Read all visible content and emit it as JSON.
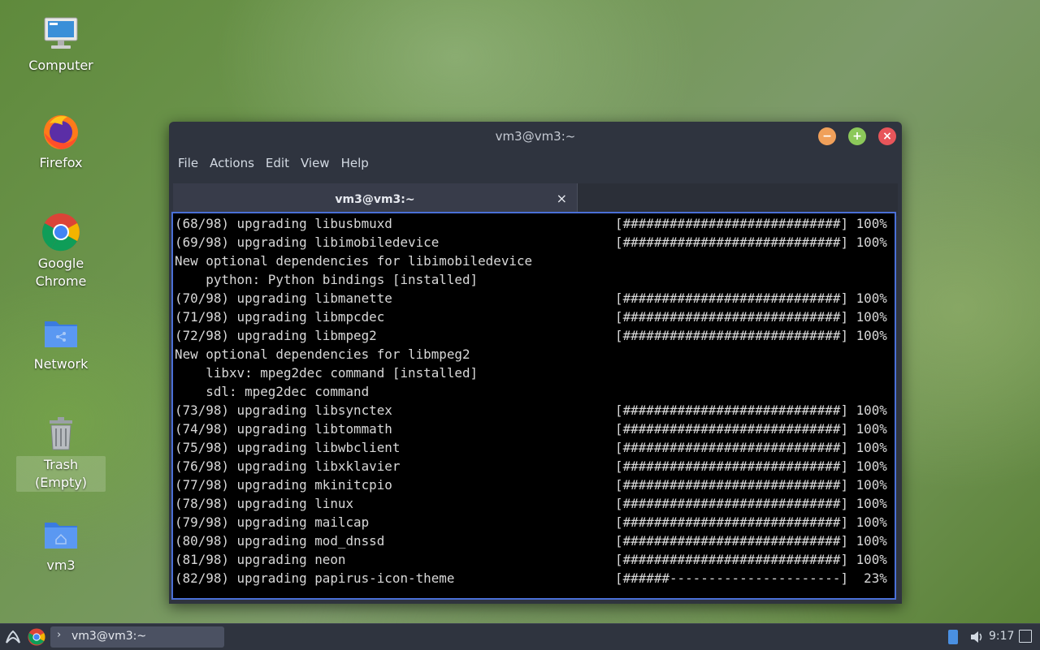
{
  "desktop": {
    "icons": [
      {
        "label": "Computer"
      },
      {
        "label": "Firefox"
      },
      {
        "label": "Google Chrome"
      },
      {
        "label": "Network"
      },
      {
        "label": "Trash (Empty)"
      },
      {
        "label": "vm3"
      }
    ]
  },
  "window": {
    "title": "vm3@vm3:~",
    "menu": [
      "File",
      "Actions",
      "Edit",
      "View",
      "Help"
    ],
    "tab": {
      "label": "vm3@vm3:~",
      "close": "×"
    },
    "colors": {
      "minimize": "#f0a05a",
      "maximize": "#8cc85a",
      "close": "#e8555a",
      "focus_border": "#4a6fd6"
    }
  },
  "terminal": {
    "lines": [
      {
        "left": "(68/98) upgrading libusbmuxd",
        "right": "[############################] 100%"
      },
      {
        "left": "(69/98) upgrading libimobiledevice",
        "right": "[############################] 100%"
      },
      {
        "left": "New optional dependencies for libimobiledevice",
        "right": ""
      },
      {
        "left": "    python: Python bindings [installed]",
        "right": ""
      },
      {
        "left": "(70/98) upgrading libmanette",
        "right": "[############################] 100%"
      },
      {
        "left": "(71/98) upgrading libmpcdec",
        "right": "[############################] 100%"
      },
      {
        "left": "(72/98) upgrading libmpeg2",
        "right": "[############################] 100%"
      },
      {
        "left": "New optional dependencies for libmpeg2",
        "right": ""
      },
      {
        "left": "    libxv: mpeg2dec command [installed]",
        "right": ""
      },
      {
        "left": "    sdl: mpeg2dec command",
        "right": ""
      },
      {
        "left": "(73/98) upgrading libsynctex",
        "right": "[############################] 100%"
      },
      {
        "left": "(74/98) upgrading libtommath",
        "right": "[############################] 100%"
      },
      {
        "left": "(75/98) upgrading libwbclient",
        "right": "[############################] 100%"
      },
      {
        "left": "(76/98) upgrading libxklavier",
        "right": "[############################] 100%"
      },
      {
        "left": "(77/98) upgrading mkinitcpio",
        "right": "[############################] 100%"
      },
      {
        "left": "(78/98) upgrading linux",
        "right": "[############################] 100%"
      },
      {
        "left": "(79/98) upgrading mailcap",
        "right": "[############################] 100%"
      },
      {
        "left": "(80/98) upgrading mod_dnssd",
        "right": "[############################] 100%"
      },
      {
        "left": "(81/98) upgrading neon",
        "right": "[############################] 100%"
      },
      {
        "left": "(82/98) upgrading papirus-icon-theme",
        "right": "[######----------------------]  23%"
      }
    ]
  },
  "taskbar": {
    "task_label": "vm3@vm3:~",
    "clock": "9:17"
  }
}
